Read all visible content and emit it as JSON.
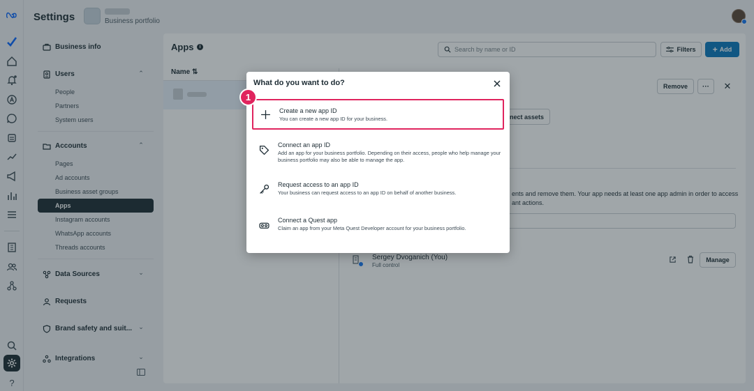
{
  "header": {
    "title": "Settings",
    "portfolio_label": "Business portfolio"
  },
  "sidebar": {
    "business_info": "Business info",
    "users": {
      "label": "Users",
      "items": [
        "People",
        "Partners",
        "System users"
      ]
    },
    "accounts": {
      "label": "Accounts",
      "items": [
        "Pages",
        "Ad accounts",
        "Business asset groups",
        "Apps",
        "Instagram accounts",
        "WhatsApp accounts",
        "Threads accounts"
      ],
      "active": "Apps"
    },
    "data_sources": "Data Sources",
    "requests": "Requests",
    "brand_safety": "Brand safety and suit...",
    "integrations": "Integrations"
  },
  "main": {
    "title": "Apps",
    "search_placeholder": "Search by name or ID",
    "filters_label": "Filters",
    "add_label": "Add",
    "column_name": "Name",
    "remove_label": "Remove",
    "more_label": "···",
    "connect_assets_label": "nnect assets",
    "desc_line1": "ents and remove them. Your app needs at least one app admin in order to access",
    "desc_line2": "ant actions.",
    "person": {
      "name": "Sergey Dvoganich (You)",
      "role": "Full control"
    },
    "manage_label": "Manage"
  },
  "modal": {
    "title": "What do you want to do?",
    "options": [
      {
        "title": "Create a new app ID",
        "desc": "You can create a new app ID for your business.",
        "icon": "plus-icon"
      },
      {
        "title": "Connect an app ID",
        "desc": "Add an app for your business portfolio. Depending on their access, people who help manage your business portfolio may also be able to manage the app.",
        "icon": "tag-icon"
      },
      {
        "title": "Request access to an app ID",
        "desc": "Your business can request access to an app ID on behalf of another business.",
        "icon": "key-icon"
      },
      {
        "title": "Connect a Quest app",
        "desc": "Claim an app from your Meta Quest Developer account for your business portfolio.",
        "icon": "vr-headset-icon"
      }
    ]
  },
  "annotation": {
    "step": "1"
  },
  "colors": {
    "accent": "#0a78be",
    "highlight": "#e0245e",
    "sidebar_active": "#1c2b33"
  }
}
